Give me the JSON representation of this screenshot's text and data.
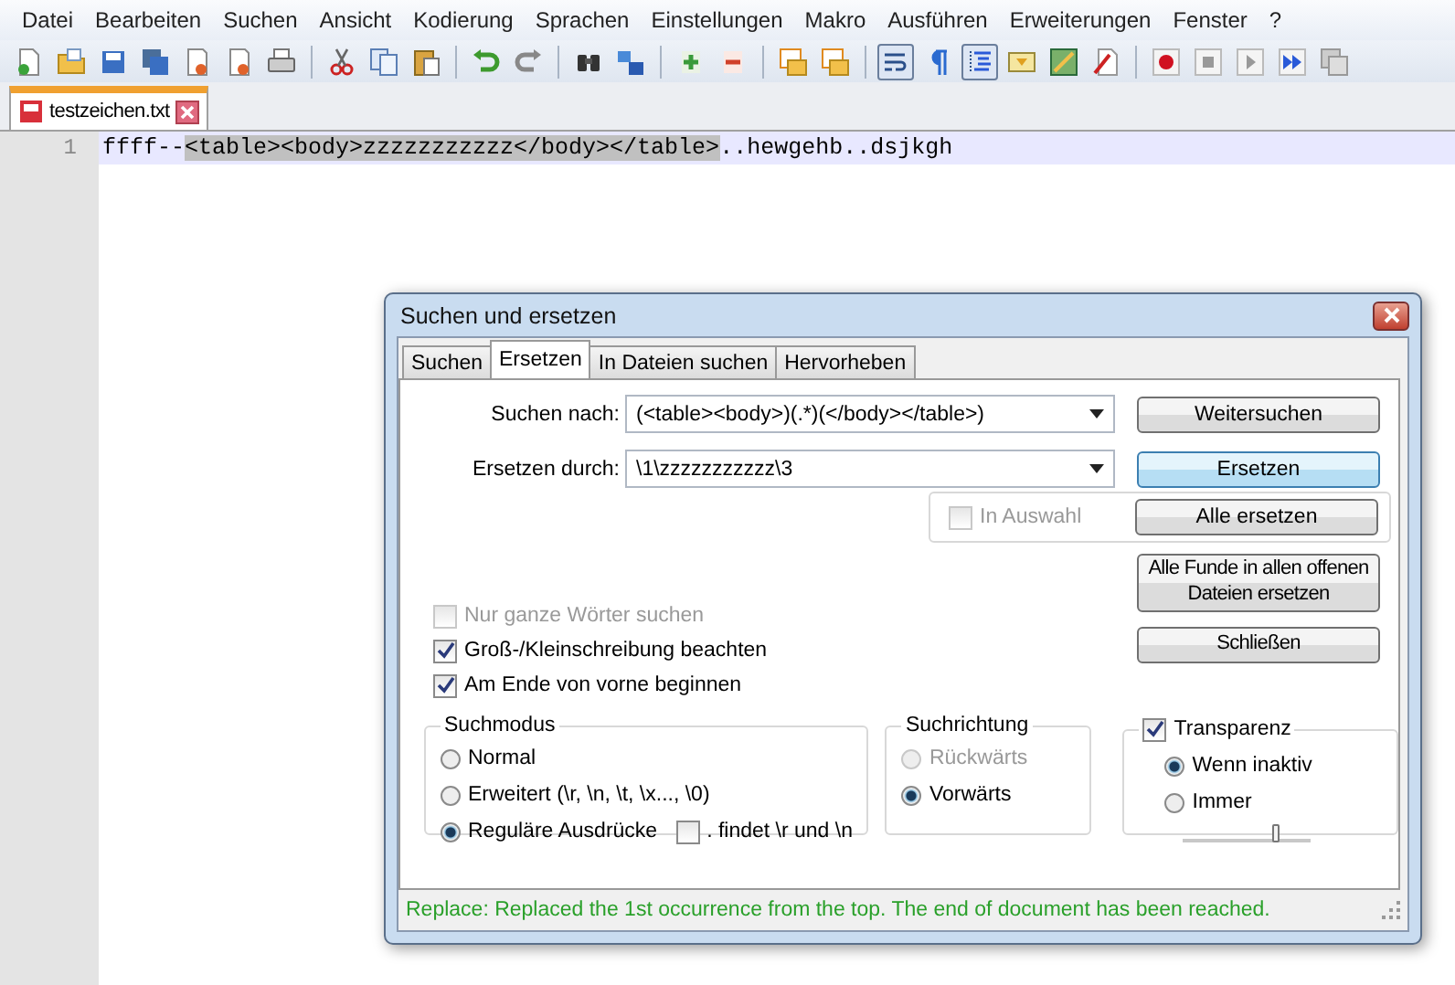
{
  "menu": [
    "Datei",
    "Bearbeiten",
    "Suchen",
    "Ansicht",
    "Kodierung",
    "Sprachen",
    "Einstellungen",
    "Makro",
    "Ausführen",
    "Erweiterungen",
    "Fenster",
    "?"
  ],
  "toolbar": [
    {
      "pressed": false
    },
    {
      "pressed": false
    },
    {
      "pressed": false
    },
    {
      "pressed": false
    },
    {
      "pressed": false
    },
    {
      "pressed": false
    },
    {
      "pressed": false
    },
    {
      "pressed": false
    },
    {
      "pressed": false
    },
    {
      "pressed": false
    },
    {
      "pressed": false
    },
    {
      "pressed": false
    },
    {
      "pressed": false
    },
    {
      "pressed": false
    },
    {
      "pressed": false
    },
    {
      "pressed": false
    },
    {
      "pressed": false
    },
    {
      "pressed": false
    },
    {
      "pressed": true
    },
    {
      "pressed": false
    },
    {
      "pressed": true
    },
    {
      "pressed": false
    },
    {
      "pressed": false
    },
    {
      "pressed": false
    },
    {
      "pressed": false
    },
    {
      "pressed": false
    },
    {
      "pressed": false
    },
    {
      "pressed": false
    },
    {
      "pressed": false
    }
  ],
  "file_tabs": [
    {
      "label": "testzeichen.txt",
      "selected": true
    }
  ],
  "editor": {
    "lines": [
      {
        "number": "1",
        "segments": [
          {
            "text": "ffff--",
            "selected": false
          },
          {
            "text": "<table><body>zzzzzzzzzzz</body></table>",
            "selected": true
          },
          {
            "text": "..hewgehb..dsjkgh",
            "selected": false
          }
        ]
      }
    ]
  },
  "dialog": {
    "title": "Suchen und ersetzen",
    "tabs": [
      {
        "label": "Suchen",
        "selected": false
      },
      {
        "label": "Ersetzen",
        "selected": true
      },
      {
        "label": "In Dateien suchen",
        "selected": false
      },
      {
        "label": "Hervorheben",
        "selected": false
      }
    ],
    "fields": [
      {
        "label": "Suchen nach:",
        "value": "(<table><body>)(.*)(</body></table>)"
      },
      {
        "label": "Ersetzen durch:",
        "value": "\\1\\zzzzzzzzzzz\\3"
      }
    ],
    "buttons": [
      {
        "label": "Weitersuchen",
        "focused": false
      },
      {
        "label": "Ersetzen",
        "focused": true
      },
      {
        "label": "Alle ersetzen",
        "focused": false
      },
      {
        "label": "Alle Funde in allen offenen Dateien ersetzen",
        "focused": false
      },
      {
        "label": "Schließen",
        "focused": false
      }
    ],
    "in_selection": {
      "label": "In Auswahl",
      "checked": false,
      "disabled": true
    },
    "options": [
      {
        "label": "Nur ganze Wörter suchen",
        "checked": false,
        "disabled": true
      },
      {
        "label": "Groß-/Kleinschreibung beachten",
        "checked": true,
        "disabled": false
      },
      {
        "label": "Am Ende von vorne beginnen",
        "checked": true,
        "disabled": false
      }
    ],
    "search_mode": {
      "title": "Suchmodus",
      "options": [
        {
          "label": "Normal",
          "selected": false
        },
        {
          "label": "Erweitert (\\r, \\n, \\t, \\x..., \\0)",
          "selected": false
        },
        {
          "label": "Reguläre Ausdrücke",
          "selected": true
        }
      ],
      "dot_matches": {
        "label": ". findet \\r und \\n",
        "checked": false
      }
    },
    "direction": {
      "title": "Suchrichtung",
      "options": [
        {
          "label": "Rückwärts",
          "selected": false,
          "disabled": true
        },
        {
          "label": "Vorwärts",
          "selected": true,
          "disabled": false
        }
      ]
    },
    "transparency": {
      "label": "Transparenz",
      "checked": true,
      "options": [
        {
          "label": "Wenn inaktiv",
          "selected": true
        },
        {
          "label": "Immer",
          "selected": false
        }
      ],
      "level": 0.72
    },
    "status": "Replace: Replaced the 1st occurrence from the top. The end of document has been reached."
  }
}
